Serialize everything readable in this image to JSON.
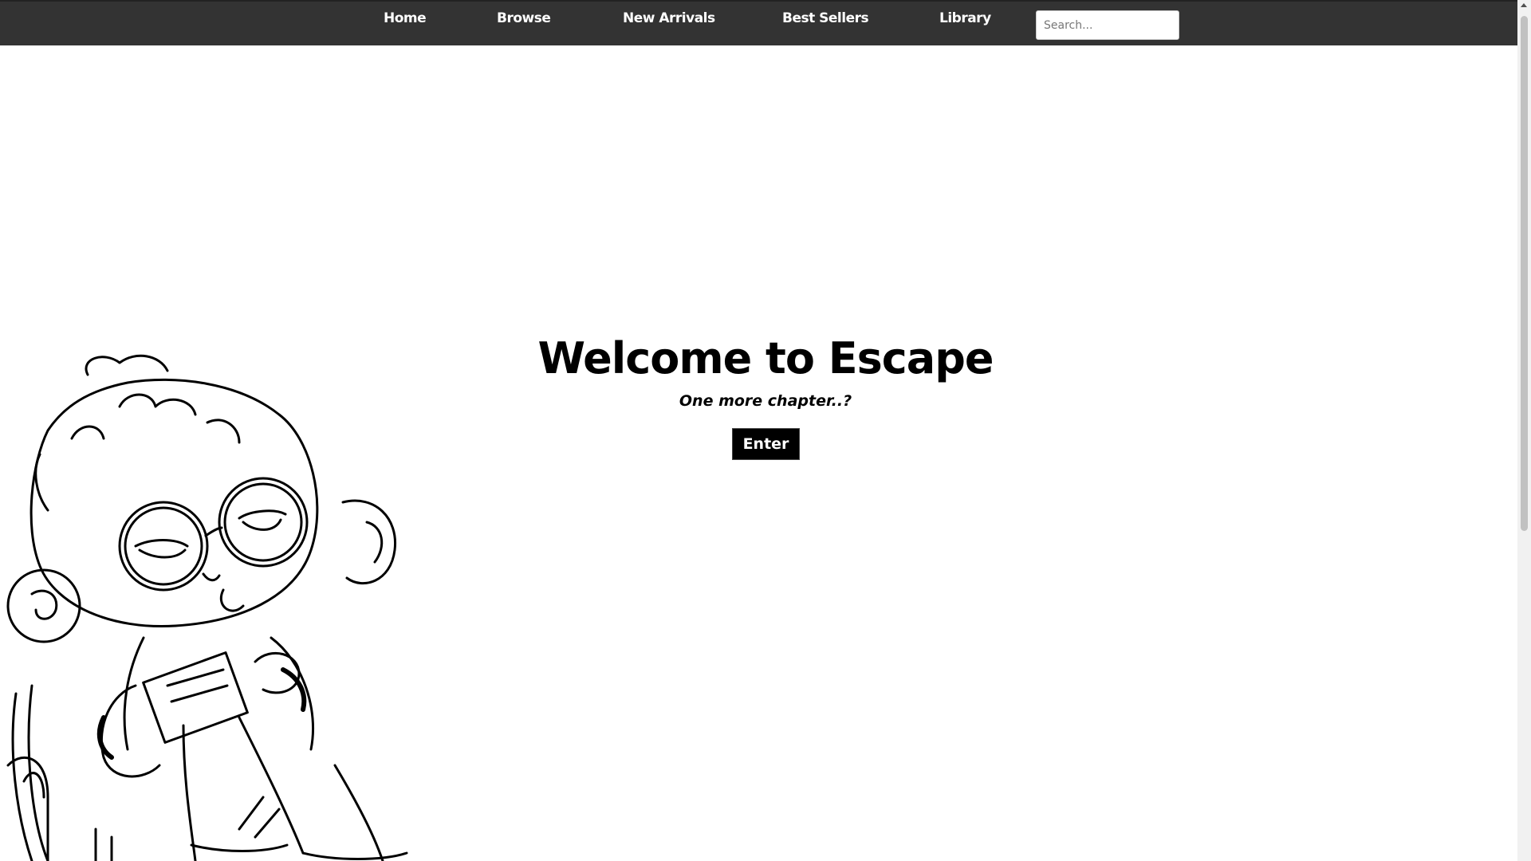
{
  "nav": {
    "items": [
      {
        "label": "Home"
      },
      {
        "label": "Browse"
      },
      {
        "label": "New Arrivals"
      },
      {
        "label": "Best Sellers"
      },
      {
        "label": "Library"
      }
    ],
    "search_placeholder": "Search..."
  },
  "hero": {
    "title": "Welcome to Escape",
    "subtitle": "One more chapter..?",
    "button_label": "Enter"
  },
  "colors": {
    "navbar_bg": "#333333",
    "button_bg": "#000000",
    "page_bg": "#ffffff"
  },
  "illustration": {
    "subject": "line-art character with glasses reading a book in an armchair"
  }
}
